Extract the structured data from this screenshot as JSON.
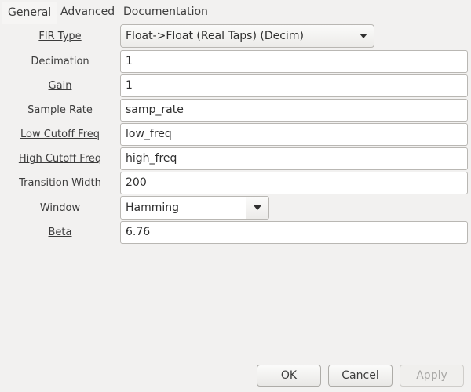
{
  "tabs": [
    {
      "label": "General",
      "active": true
    },
    {
      "label": "Advanced",
      "active": false
    },
    {
      "label": "Documentation",
      "active": false
    }
  ],
  "form": {
    "fir_type": {
      "label": "FIR Type",
      "value": "Float->Float (Real Taps) (Decim)"
    },
    "decimation": {
      "label": "Decimation",
      "value": "1"
    },
    "gain": {
      "label": "Gain",
      "value": "1"
    },
    "sample_rate": {
      "label": "Sample Rate",
      "value": "samp_rate"
    },
    "low_cutoff": {
      "label": "Low Cutoff Freq",
      "value": "low_freq"
    },
    "high_cutoff": {
      "label": "High Cutoff Freq",
      "value": "high_freq"
    },
    "transition_width": {
      "label": "Transition Width",
      "value": "200"
    },
    "window": {
      "label": "Window",
      "value": "Hamming"
    },
    "beta": {
      "label": "Beta",
      "value": "6.76"
    }
  },
  "buttons": {
    "ok": "OK",
    "cancel": "Cancel",
    "apply": "Apply"
  }
}
